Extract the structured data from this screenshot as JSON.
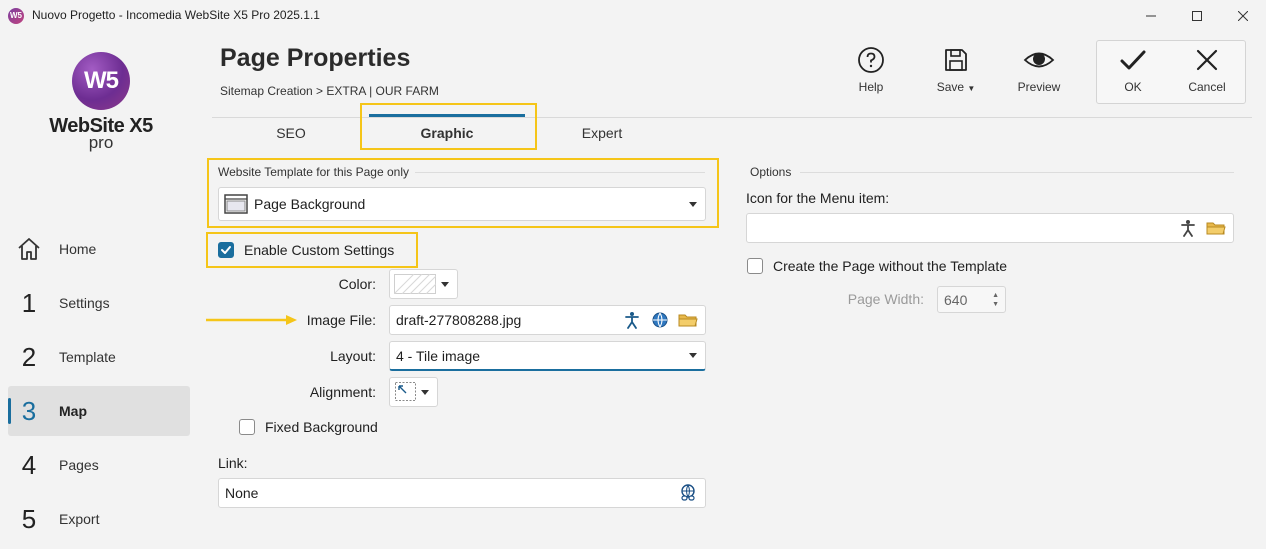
{
  "window": {
    "title": "Nuovo Progetto - Incomedia WebSite X5 Pro 2025.1.1",
    "app_icon": "W5"
  },
  "logo": {
    "mark": "W5",
    "name": "WebSite X5",
    "edition": "pro"
  },
  "sidebar": {
    "items": [
      {
        "num": "",
        "label": "Home",
        "icon": "home-icon"
      },
      {
        "num": "1",
        "label": "Settings"
      },
      {
        "num": "2",
        "label": "Template"
      },
      {
        "num": "3",
        "label": "Map",
        "active": true
      },
      {
        "num": "4",
        "label": "Pages"
      },
      {
        "num": "5",
        "label": "Export"
      }
    ]
  },
  "header": {
    "title": "Page Properties",
    "breadcrumb": "Sitemap Creation > EXTRA | OUR FARM"
  },
  "toolbar": {
    "help": "Help",
    "save": "Save",
    "preview": "Preview",
    "ok": "OK",
    "cancel": "Cancel"
  },
  "tabs": [
    {
      "label": "SEO"
    },
    {
      "label": "Graphic",
      "active": true
    },
    {
      "label": "Expert"
    }
  ],
  "graphic": {
    "template_section": "Website Template for this Page only",
    "template_value": "Page Background",
    "enable_custom": "Enable Custom Settings",
    "enable_custom_checked": true,
    "color_label": "Color:",
    "image_label": "Image File:",
    "image_value": "draft-277808288.jpg",
    "layout_label": "Layout:",
    "layout_value": "4 - Tile image",
    "alignment_label": "Alignment:",
    "fixed_bg": "Fixed Background",
    "fixed_bg_checked": false,
    "link_label": "Link:",
    "link_value": "None"
  },
  "options": {
    "section": "Options",
    "icon_label": "Icon for the Menu item:",
    "icon_value": "",
    "no_template": "Create the Page without the Template",
    "no_template_checked": false,
    "page_width_label": "Page Width:",
    "page_width_value": "640"
  },
  "colors": {
    "accent": "#1a6e9e",
    "highlight": "#f5c518"
  }
}
